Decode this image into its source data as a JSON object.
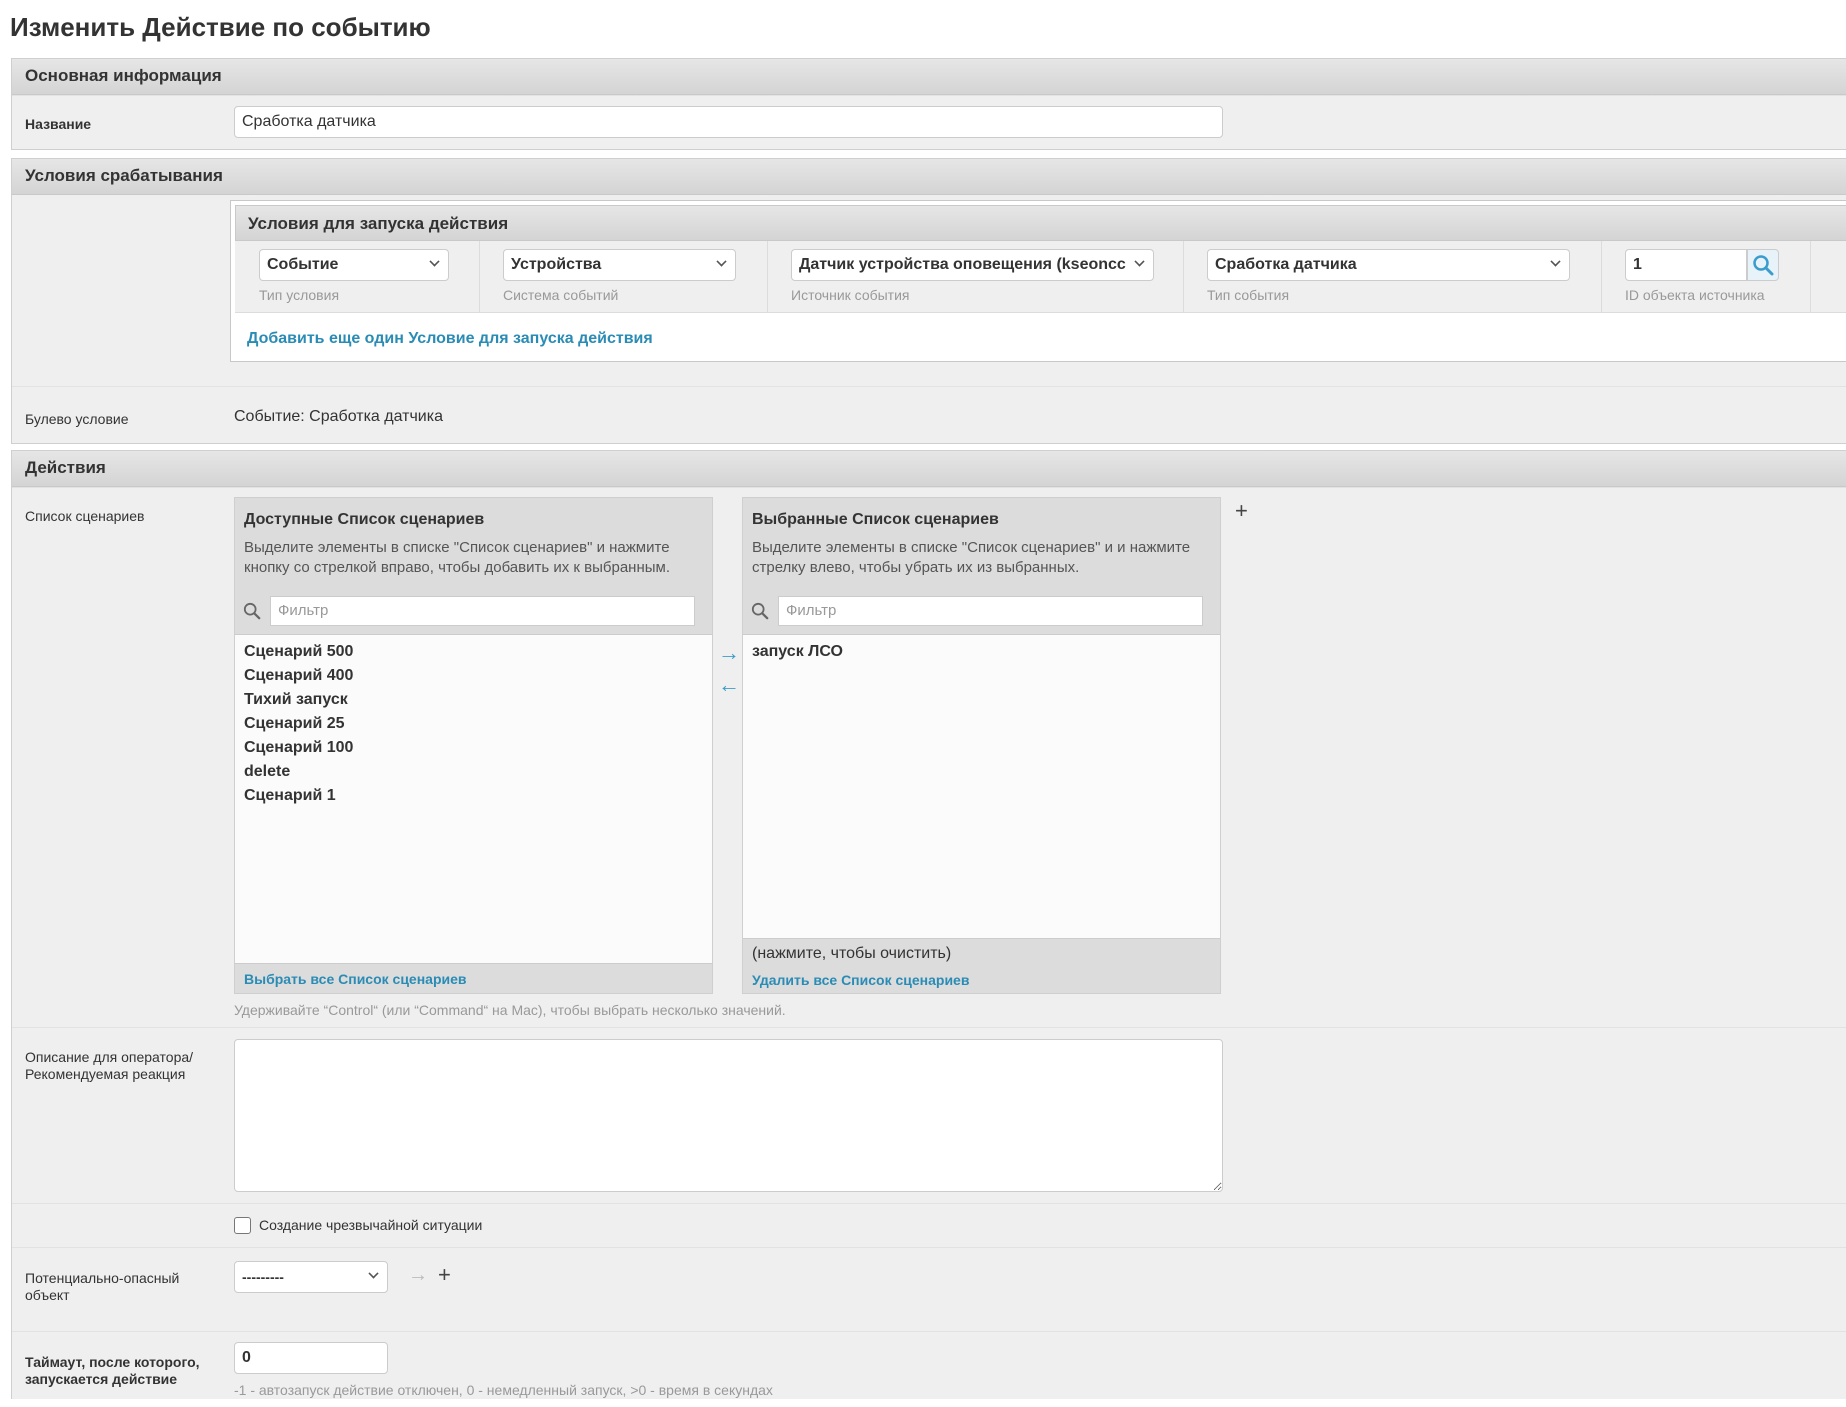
{
  "page_title": "Изменить Действие по событию",
  "basic": {
    "header": "Основная информация",
    "name_label": "Название",
    "name_value": "Сработка датчика"
  },
  "conditions": {
    "header": "Условия срабатывания",
    "inline_header": "Условия для запуска действия",
    "condition_type": {
      "value": "Событие",
      "help": "Тип условия"
    },
    "event_system": {
      "value": "Устройства",
      "help": "Система событий"
    },
    "event_source": {
      "value": "Датчик устройства оповещения (kseoncc",
      "help": "Источник события"
    },
    "event_type": {
      "value": "Сработка датчика",
      "help": "Тип события"
    },
    "source_id": {
      "value": "1",
      "help": "ID объекта источника"
    },
    "add_link": "Добавить еще один Условие для запуска действия",
    "bool_label": "Булево условие",
    "bool_value": "Событие: Сработка датчика"
  },
  "actions": {
    "header": "Действия",
    "scenarios_label": "Список сценариев",
    "available": {
      "title": "Доступные Список сценариев",
      "desc": "Выделите элементы в списке \"Список сценариев\" и нажмите кнопку со стрелкой вправо, чтобы добавить их к выбранным.",
      "filter_placeholder": "Фильтр",
      "items": [
        "Сценарий 500",
        "Сценарий 400",
        "Тихий запуск",
        "Сценарий 25",
        "Сценарий 100",
        "delete",
        "Сценарий 1"
      ],
      "choose_all": "Выбрать все Список сценариев"
    },
    "chosen": {
      "title": "Выбранные Список сценариев",
      "desc": "Выделите элементы в списке \"Список сценариев\" и и нажмите стрелку влево, чтобы убрать их из выбранных.",
      "filter_placeholder": "Фильтр",
      "items": [
        "запуск ЛСО"
      ],
      "clear_hint": "(нажмите, чтобы очистить)",
      "remove_all": "Удалить все Список сценариев"
    },
    "multi_help": "Удерживайте “Control“ (или “Command“ на Mac), чтобы выбрать несколько значений.",
    "description_label_1": "Описание для оператора/",
    "description_label_2": "Рекомендуемая реакция",
    "emergency_label": "Создание чрезвычайной ситуации",
    "hazard_label_1": "Потенциально-опасный",
    "hazard_label_2": "объект",
    "hazard_value": "---------",
    "timeout_label_1": "Таймаут, после которого,",
    "timeout_label_2": "запускается действие",
    "timeout_value": "0",
    "timeout_help": "-1 - автозапуск действие отключен, 0 - немедленный запуск, >0 - время в секундах"
  },
  "colors": {
    "link": "#2a8cb5",
    "arrow": "#3c9ccc"
  }
}
